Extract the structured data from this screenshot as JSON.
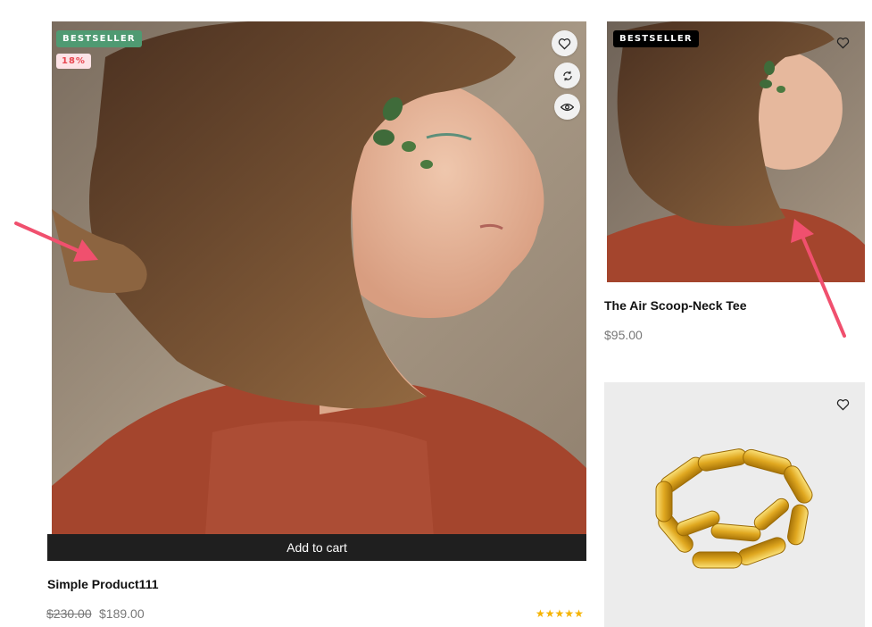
{
  "products": [
    {
      "badge": "BESTSELLER",
      "discount": "18%",
      "add_to_cart_label": "Add to cart",
      "title": "Simple Product111",
      "price_old": "$230.00",
      "price_new": "$189.00",
      "rating_stars": 5
    },
    {
      "badge": "BESTSELLER",
      "title": "The Air Scoop-Neck Tee",
      "price": "$95.00"
    },
    {
      "title": "",
      "price": ""
    }
  ],
  "icons": {
    "wishlist": "heart-icon",
    "compare": "compare-icon",
    "quick_view": "eye-icon",
    "rating_star": "star-icon",
    "annotation": "arrow-icon"
  },
  "colors": {
    "badge_green": "#4f9a72",
    "badge_black": "#000000",
    "discount_bg": "#fde3e6",
    "discount_text": "#e7464f",
    "cart_bar": "#1f1f1f",
    "star": "#f5b301",
    "annotation_arrow": "#f0506e"
  }
}
